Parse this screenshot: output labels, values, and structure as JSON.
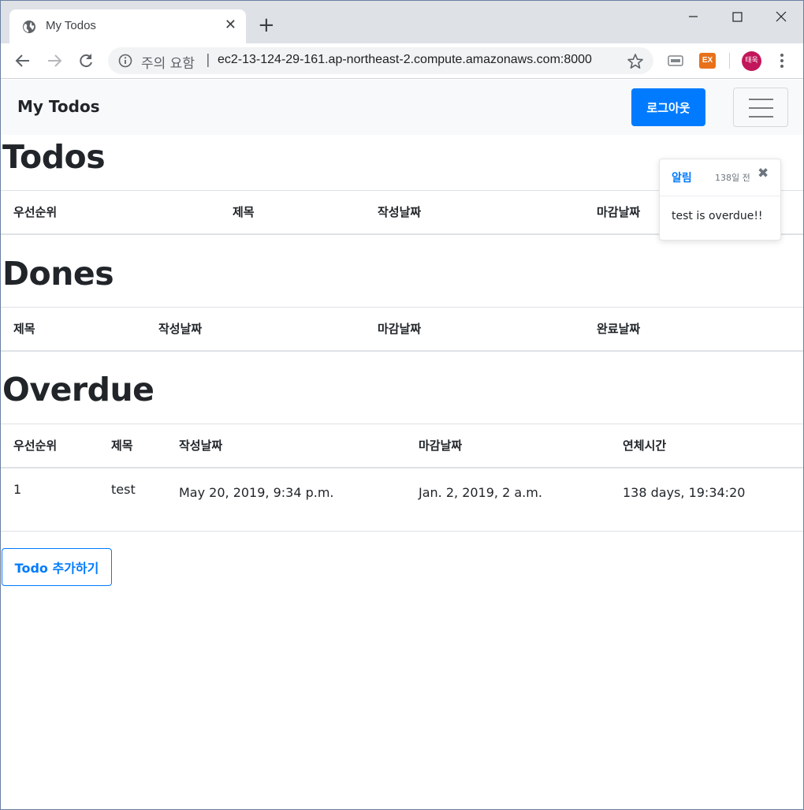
{
  "browser": {
    "tab_title": "My Todos",
    "tab_close": "✕",
    "new_tab": "+",
    "security_label": "주의 요함",
    "separator": "|",
    "url": "ec2-13-124-29-161.ap-northeast-2.compute.amazonaws.com:8000",
    "extension_label": "EX",
    "profile_initials": "태욱"
  },
  "navbar": {
    "brand": "My Todos",
    "logout_label": "로그아웃"
  },
  "todos": {
    "title": "Todos",
    "columns": [
      "우선순위",
      "제목",
      "작성날짜",
      "마감날짜"
    ],
    "rows": []
  },
  "dones": {
    "title": "Dones",
    "columns": [
      "제목",
      "작성날짜",
      "마감날짜",
      "완료날짜"
    ],
    "rows": []
  },
  "overdue": {
    "title": "Overdue",
    "columns": [
      "우선순위",
      "제목",
      "작성날짜",
      "마감날짜",
      "연체시간"
    ],
    "rows": [
      [
        "1",
        "test",
        "May 20, 2019, 9:34 p.m.",
        "Jan. 2, 2019, 2 a.m.",
        "138 days, 19:34:20"
      ]
    ]
  },
  "add_button_label": "Todo 추가하기",
  "toast": {
    "title": "알림",
    "time": "138일 전",
    "close": "✖",
    "message": "test is overdue!!"
  },
  "colors": {
    "primary": "#007bff",
    "navbar_bg": "#f8f9fa",
    "chrome_frame": "#dee1e6"
  }
}
